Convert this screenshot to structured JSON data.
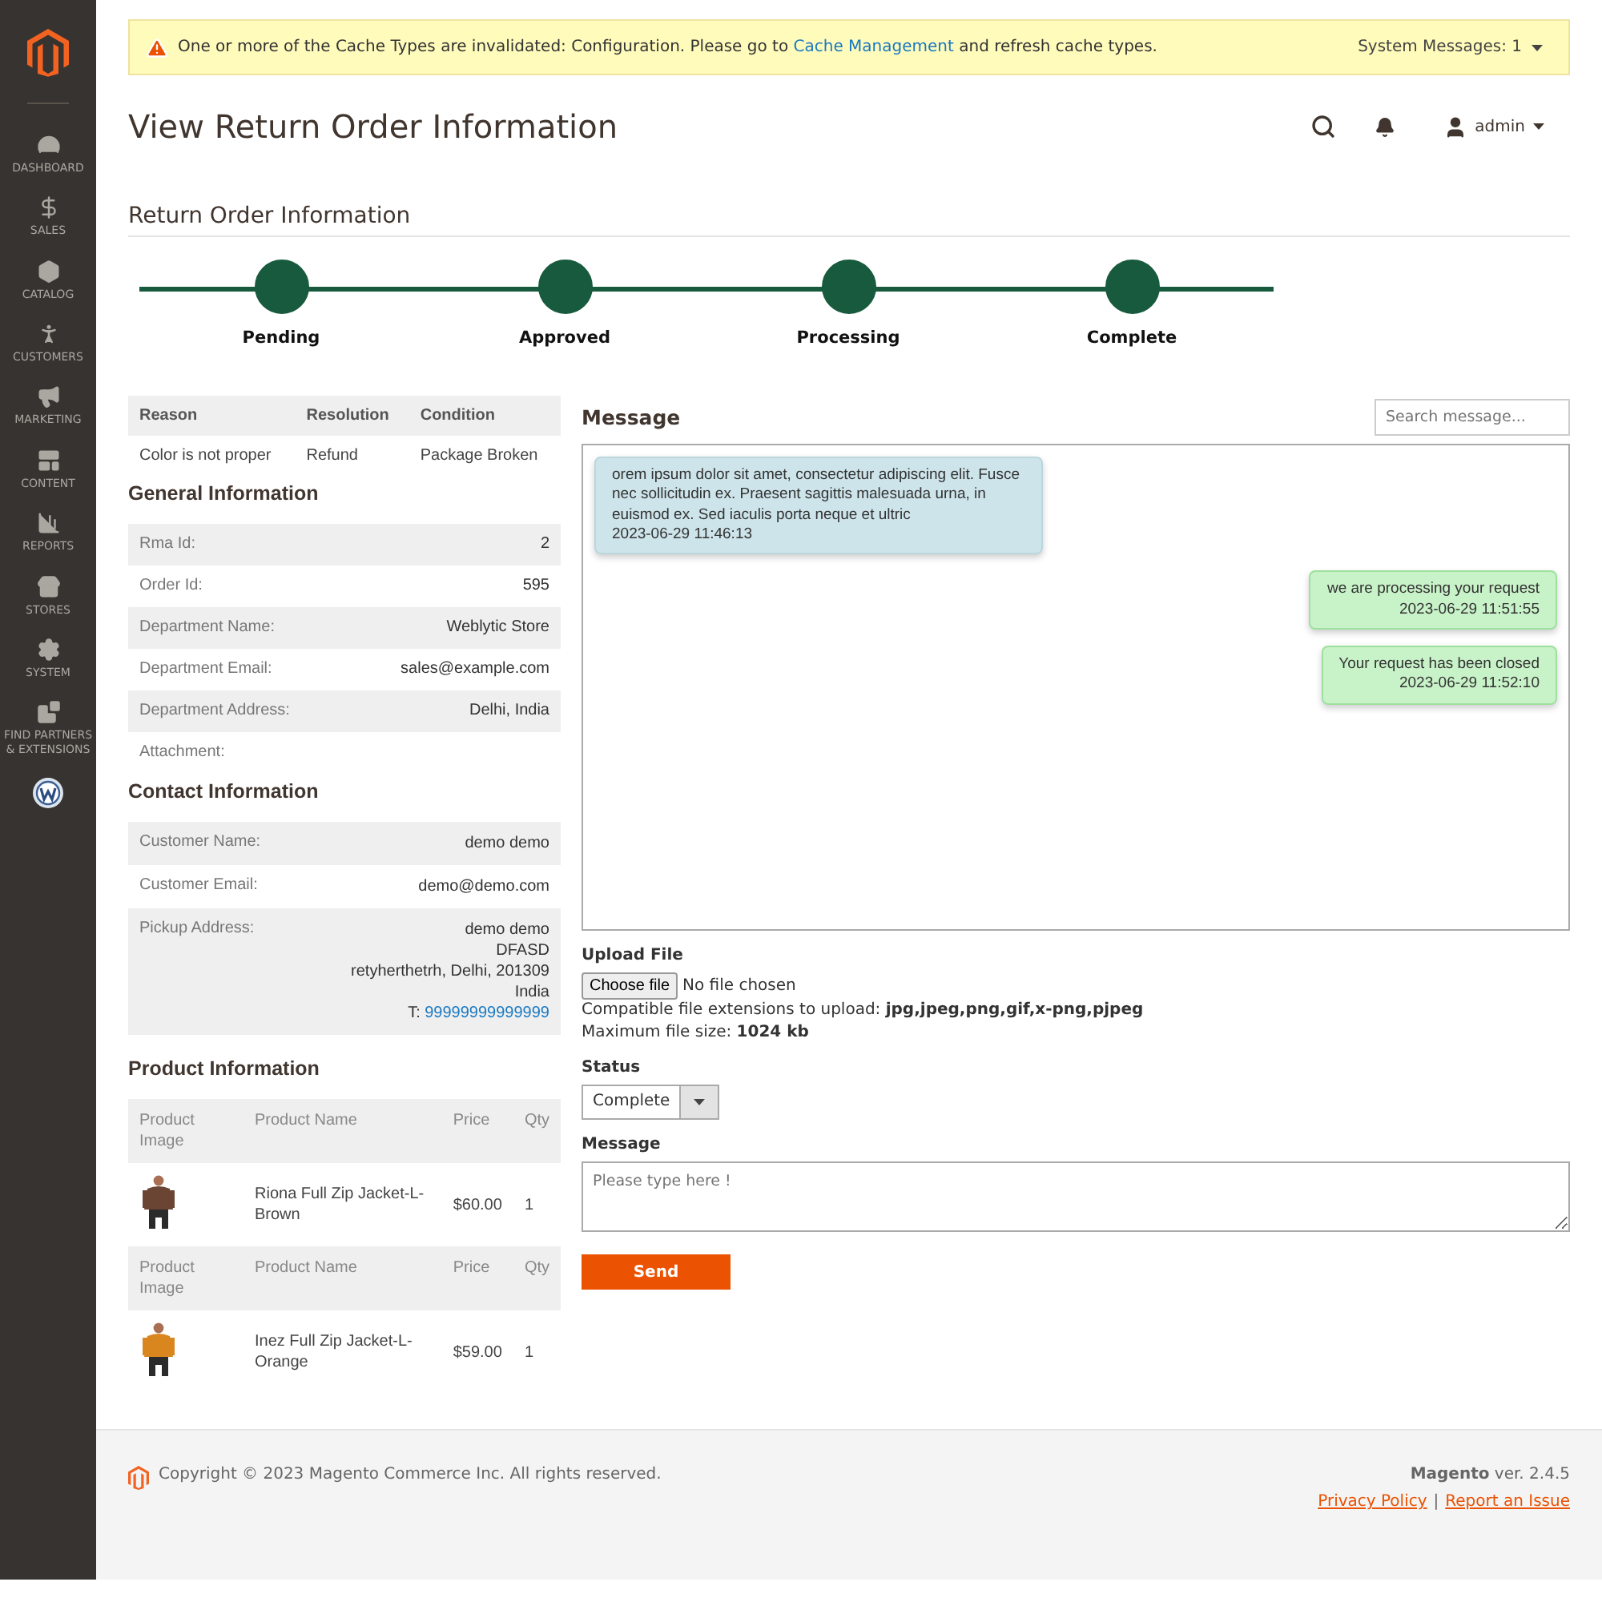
{
  "sidebar": {
    "items": [
      {
        "label": "DASHBOARD"
      },
      {
        "label": "SALES"
      },
      {
        "label": "CATALOG"
      },
      {
        "label": "CUSTOMERS"
      },
      {
        "label": "MARKETING"
      },
      {
        "label": "CONTENT"
      },
      {
        "label": "REPORTS"
      },
      {
        "label": "STORES"
      },
      {
        "label": "SYSTEM"
      },
      {
        "label": "FIND PARTNERS & EXTENSIONS"
      }
    ]
  },
  "notice": {
    "text_before": "One or more of the Cache Types are invalidated: Configuration. Please go to",
    "link": "Cache Management",
    "text_after": "and refresh cache types.",
    "system_messages": "System Messages: 1"
  },
  "header": {
    "title": "View Return Order Information",
    "user": "admin"
  },
  "section_title": "Return Order Information",
  "steps": [
    {
      "label": "Pending",
      "completed": true
    },
    {
      "label": "Approved",
      "completed": true
    },
    {
      "label": "Processing",
      "completed": true
    },
    {
      "label": "Complete",
      "completed": true
    }
  ],
  "reason_table": {
    "columns": [
      "Reason",
      "Resolution",
      "Condition"
    ],
    "rows": [
      [
        "Color is not proper",
        "Refund",
        "Package Broken"
      ]
    ]
  },
  "general_information": {
    "title": "General Information",
    "rows": [
      {
        "label": "Rma Id:",
        "value": "2"
      },
      {
        "label": "Order Id:",
        "value": "595"
      },
      {
        "label": "Department Name:",
        "value": "Weblytic Store"
      },
      {
        "label": "Department Email:",
        "value": "sales@example.com"
      },
      {
        "label": "Department Address:",
        "value": "Delhi, India"
      },
      {
        "label": "Attachment:"
      }
    ]
  },
  "contact_information": {
    "title": "Contact Information",
    "rows": [
      {
        "label": "Customer Name:",
        "lines": [
          "demo demo"
        ]
      },
      {
        "label": "Customer Email:",
        "lines": [
          "demo@demo.com"
        ]
      },
      {
        "label": "Pickup Address:",
        "lines": [
          "demo demo",
          "DFASD",
          "retyherthetrh, Delhi, 201309",
          "India"
        ],
        "phone_prefix": "T:",
        "phone": "99999999999999"
      }
    ]
  },
  "product_information": {
    "title": "Product Information",
    "products": [
      {
        "columns": [
          "Product Image",
          "Product Name",
          "Price",
          "Qty"
        ],
        "name": "Riona Full Zip Jacket-L-Brown",
        "price": "$60.00",
        "qty": "1"
      },
      {
        "columns": [
          "Product Image",
          "Product Name",
          "Price",
          "Qty"
        ],
        "name": "Inez Full Zip Jacket-L-Orange",
        "price": "$59.00",
        "qty": "1"
      }
    ]
  },
  "messages": {
    "title": "Message",
    "search_placeholder": "Search message...",
    "items": [
      {
        "kind": "incoming",
        "text": "orem ipsum dolor sit amet, consectetur adipiscing elit. Fusce nec sollicitudin ex. Praesent sagittis malesuada urna, in euismod ex. Sed iaculis porta neque et ultric",
        "time": "2023-06-29 11:46:13"
      },
      {
        "kind": "outgoing",
        "text": "we are processing your request",
        "time": "2023-06-29 11:51:55"
      },
      {
        "kind": "outgoing",
        "text": "Your request has been closed",
        "time": "2023-06-29 11:52:10"
      }
    ]
  },
  "upload": {
    "label": "Upload File",
    "button": "Choose file",
    "file_status": "No file chosen",
    "extensions_note": "Compatible file extensions to upload: **jpg,jpeg,png,gif,x-png,pjpeg**",
    "size_note": "Maximum file size: **1024 kb**"
  },
  "status": {
    "label": "Status",
    "value": "Complete"
  },
  "reply": {
    "label": "Message",
    "placeholder": "Please type here !",
    "button": "Send"
  },
  "footer": {
    "copyright": "Copyright © 2023 Magento Commerce Inc. All rights reserved.",
    "brand": "Magento",
    "version": "ver. 2.4.5",
    "links": [
      "Privacy Policy",
      "Report an Issue"
    ],
    "separator": "|"
  }
}
